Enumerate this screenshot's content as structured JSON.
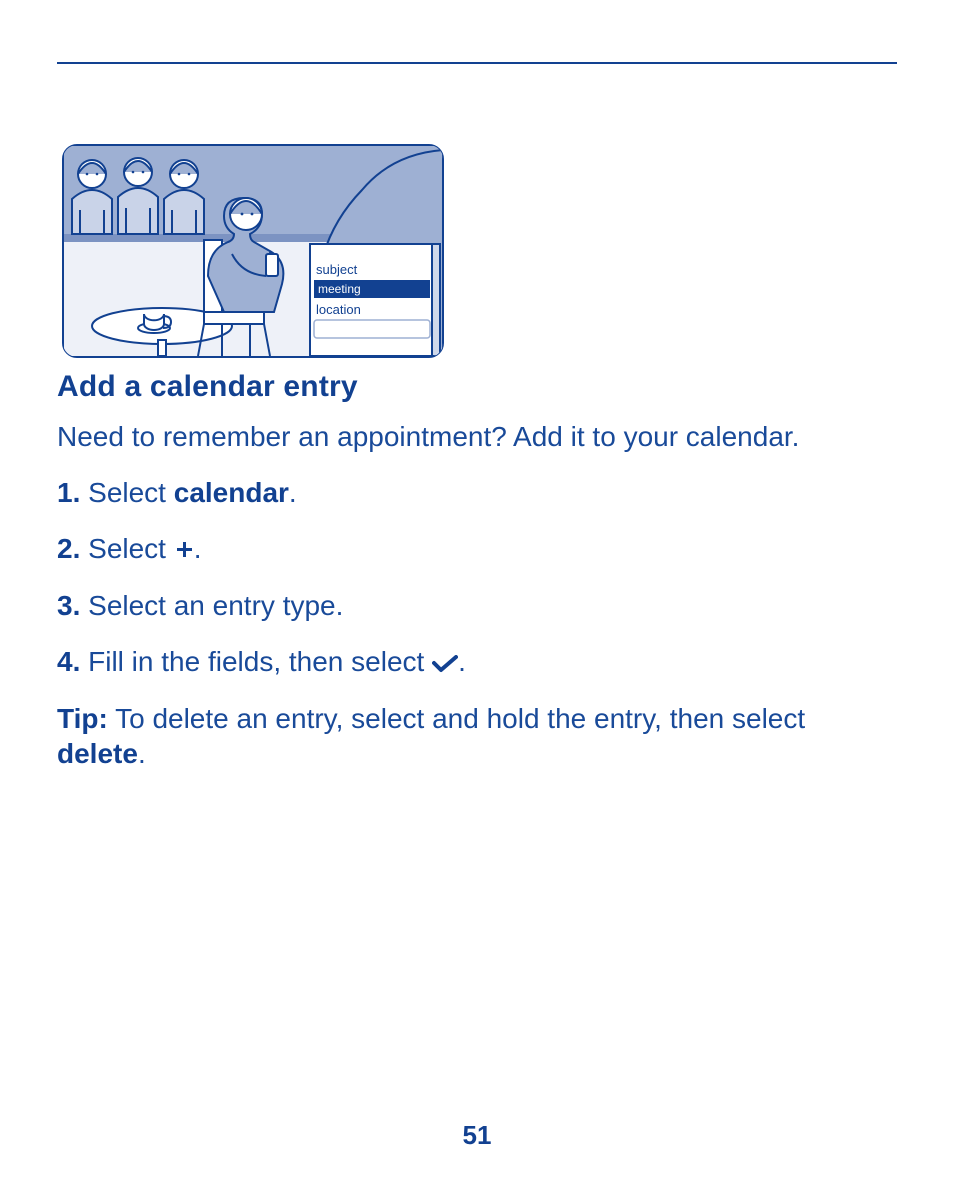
{
  "illustration": {
    "subject_label": "subject",
    "subject_value": "meeting",
    "location_label": "location"
  },
  "heading": "Add a calendar entry",
  "intro": "Need to remember an appointment? Add it to your calendar.",
  "steps": {
    "s1": {
      "num": "1.",
      "pre": " Select ",
      "kw": "calendar",
      "post": "."
    },
    "s2": {
      "num": "2.",
      "pre": " Select ",
      "post": "."
    },
    "s3": {
      "num": "3.",
      "text": " Select an entry type."
    },
    "s4": {
      "num": "4.",
      "pre": " Fill in the fields, then select ",
      "post": "."
    }
  },
  "tip": {
    "label": "Tip:",
    "text1": " To delete an entry, select and hold the entry, then select ",
    "kw": "delete",
    "text2": "."
  },
  "page_number": "51"
}
